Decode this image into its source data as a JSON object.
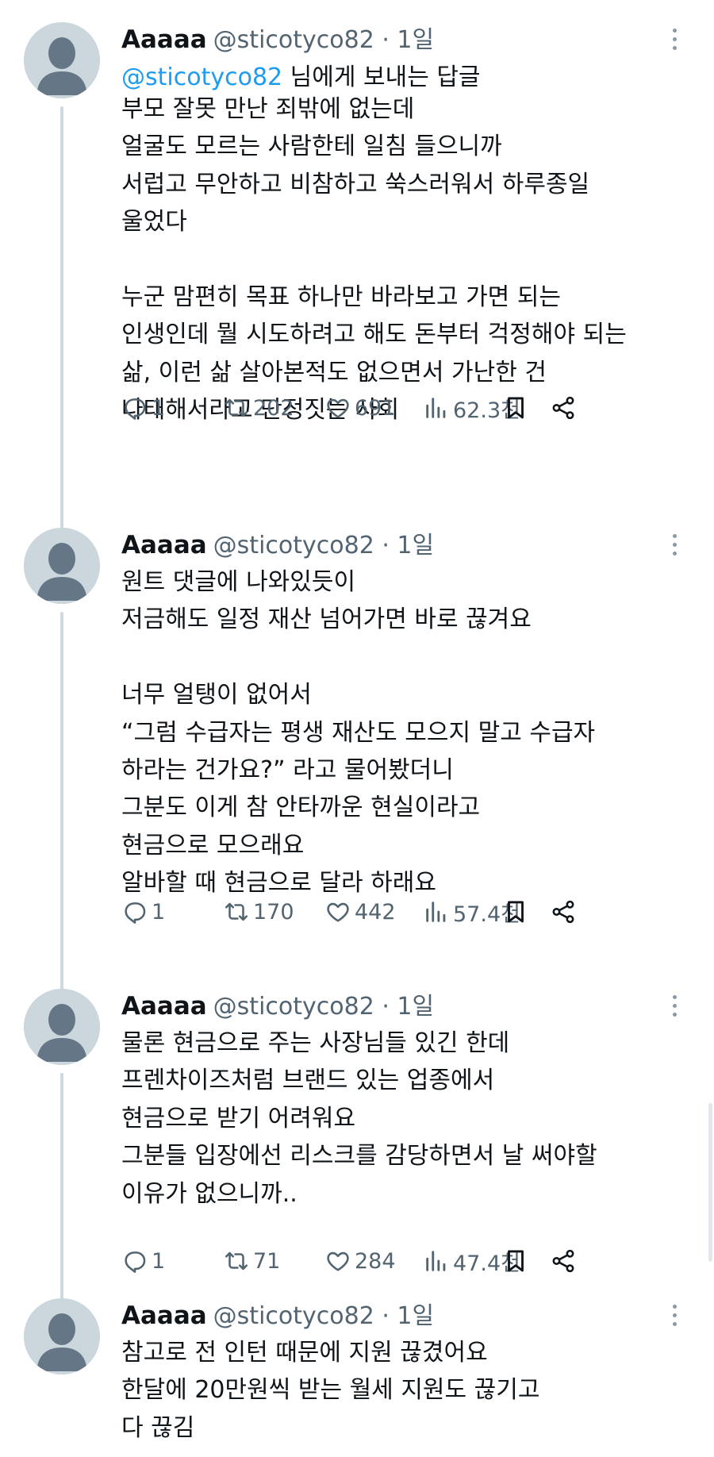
{
  "tweets": [
    {
      "name": "Aaaaa",
      "handle": "@sticotyco82 · 1일",
      "reply_to": {
        "mention": "@sticotyco82",
        "suffix": " 님에게 보내는 답글"
      },
      "text": "부모 잘못 만난 죄밖에 없는데\n얼굴도 모르는 사람한테 일침 들으니까\n서럽고 무안하고 비참하고 쑥스러워서 하루종일\n울었다\n\n누군 맘편히 목표 하나만 바라보고 가면 되는\n인생인데 뭘 시도하려고 해도 돈부터 걱정해야 되는\n삶, 이런 삶 살아본적도 없으면서 가난한 건\n나태해서라고 단정짓는 사회",
      "replies": "1",
      "retweets": "202",
      "likes": "691",
      "views": "62.3천"
    },
    {
      "name": "Aaaaa",
      "handle": "@sticotyco82 · 1일",
      "text": "원트 댓글에 나와있듯이\n저금해도 일정 재산 넘어가면 바로 끊겨요\n\n너무 얼탱이 없어서\n“그럼 수급자는 평생 재산도 모으지 말고 수급자\n하라는 건가요?” 라고 물어봤더니\n그분도 이게 참 안타까운 현실이라고\n현금으로 모으래요\n알바할 때 현금으로 달라 하래요",
      "replies": "1",
      "retweets": "170",
      "likes": "442",
      "views": "57.4천"
    },
    {
      "name": "Aaaaa",
      "handle": "@sticotyco82 · 1일",
      "text": "물론 현금으로 주는 사장님들 있긴 한데\n프렌차이즈처럼 브랜드 있는 업종에서\n현금으로 받기 어려워요\n그분들 입장에선 리스크를 감당하면서 날 써야할\n이유가 없으니까..",
      "replies": "1",
      "retweets": "71",
      "likes": "284",
      "views": "47.4천"
    },
    {
      "name": "Aaaaa",
      "handle": "@sticotyco82 · 1일",
      "text": "참고로 전 인턴 때문에 지원 끊겼어요\n한달에 20만원씩 받는 월세 지원도 끊기고\n다 끊김"
    }
  ],
  "colors": {
    "link": "#1d9bf0",
    "secondary": "#536471",
    "thread_line": "#cfd9de",
    "avatar_bg": "#ccd6dd",
    "avatar_fg": "#657786"
  },
  "icons": [
    "reply-icon",
    "retweet-icon",
    "like-icon",
    "views-icon",
    "bookmark-icon",
    "share-icon",
    "more-icon",
    "default-avatar-icon"
  ]
}
